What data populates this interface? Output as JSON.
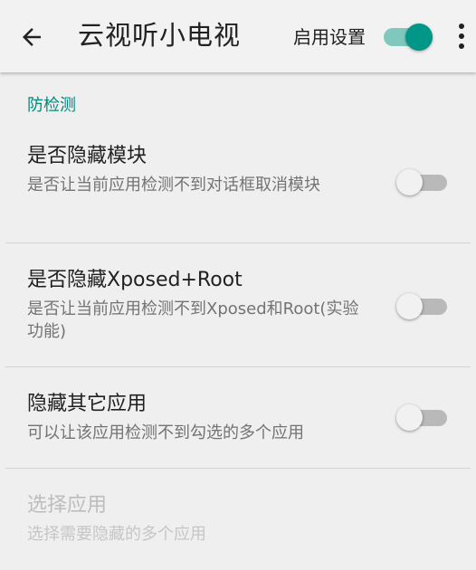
{
  "app_bar": {
    "back_icon": "arrow-back-icon",
    "title": "云视听小电视",
    "enable_label": "启用设置",
    "enable_switch_on": true,
    "more_icon": "more-vert-icon"
  },
  "accent_color": "#009688",
  "category": {
    "title": "防检测"
  },
  "preferences": [
    {
      "title": "是否隐藏模块",
      "summary": "是否让当前应用检测不到对话框取消模块",
      "switch_on": false
    },
    {
      "title": "是否隐藏Xposed+Root",
      "summary": "是否让当前应用检测不到Xposed和Root(实验功能)",
      "switch_on": false
    },
    {
      "title": "隐藏其它应用",
      "summary": "可以让该应用检测不到勾选的多个应用",
      "switch_on": false
    },
    {
      "title": "选择应用",
      "summary": "选择需要隐藏的多个应用",
      "enabled": false
    }
  ]
}
